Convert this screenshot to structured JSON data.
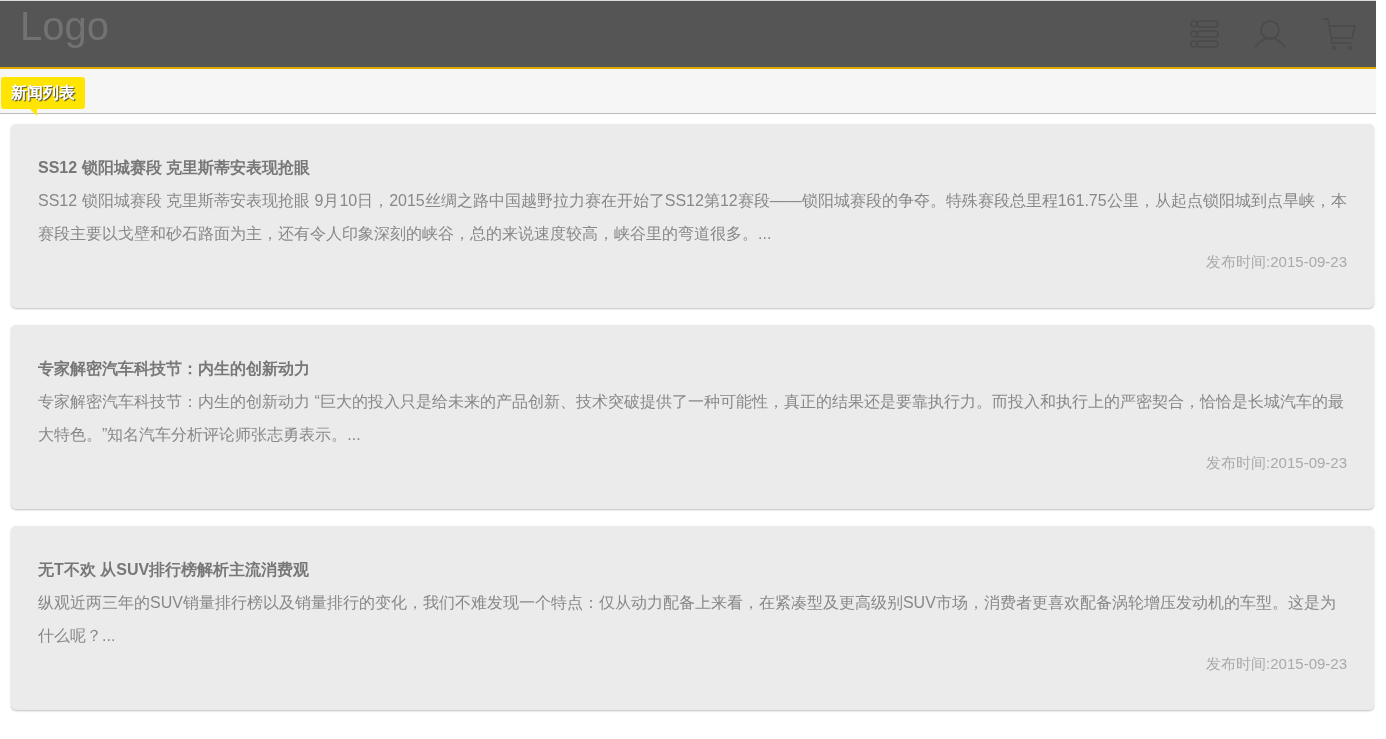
{
  "header": {
    "logo": "Logo"
  },
  "section": {
    "title": "新闻列表"
  },
  "news": [
    {
      "title": "SS12 锁阳城赛段 克里斯蒂安表现抢眼",
      "summary": "SS12 锁阳城赛段 克里斯蒂安表现抢眼 9月10日，2015丝绸之路中国越野拉力赛在开始了SS12第12赛段——锁阳城赛段的争夺。特殊赛段总里程161.75公里，从起点锁阳城到点旱峡，本赛段主要以戈壁和砂石路面为主，还有令人印象深刻的峡谷，总的来说速度较高，峡谷里的弯道很多。...",
      "date": "发布时间:2015-09-23"
    },
    {
      "title": "专家解密汽车科技节：内生的创新动力",
      "summary": "专家解密汽车科技节：内生的创新动力 “巨大的投入只是给未来的产品创新、技术突破提供了一种可能性，真正的结果还是要靠执行力。而投入和执行上的严密契合，恰恰是长城汽车的最大特色。”知名汽车分析评论师张志勇表示。...",
      "date": "发布时间:2015-09-23"
    },
    {
      "title": "无T不欢 从SUV排行榜解析主流消费观",
      "summary": "纵观近两三年的SUV销量排行榜以及销量排行的变化，我们不难发现一个特点：仅从动力配备上来看，在紧凑型及更高级别SUV市场，消费者更喜欢配备涡轮增压发动机的车型。这是为什么呢？...",
      "date": "发布时间:2015-09-23"
    }
  ]
}
